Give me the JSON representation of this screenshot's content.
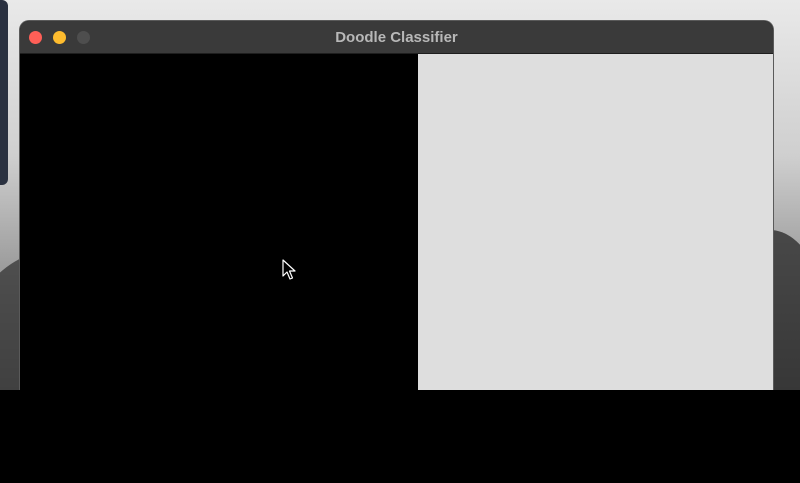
{
  "window": {
    "title": "Doodle Classifier"
  },
  "titlebar": {
    "buttons": [
      {
        "name": "close",
        "color": "#ff5f57"
      },
      {
        "name": "minimize",
        "color": "#febc2e"
      },
      {
        "name": "zoom",
        "color": "#4e4e4e"
      }
    ]
  },
  "drawing_canvas": {
    "background": "#000000"
  },
  "prediction_panel": {
    "background": "#dedede"
  },
  "cursor": {
    "icon": "arrow-pointer-icon"
  }
}
